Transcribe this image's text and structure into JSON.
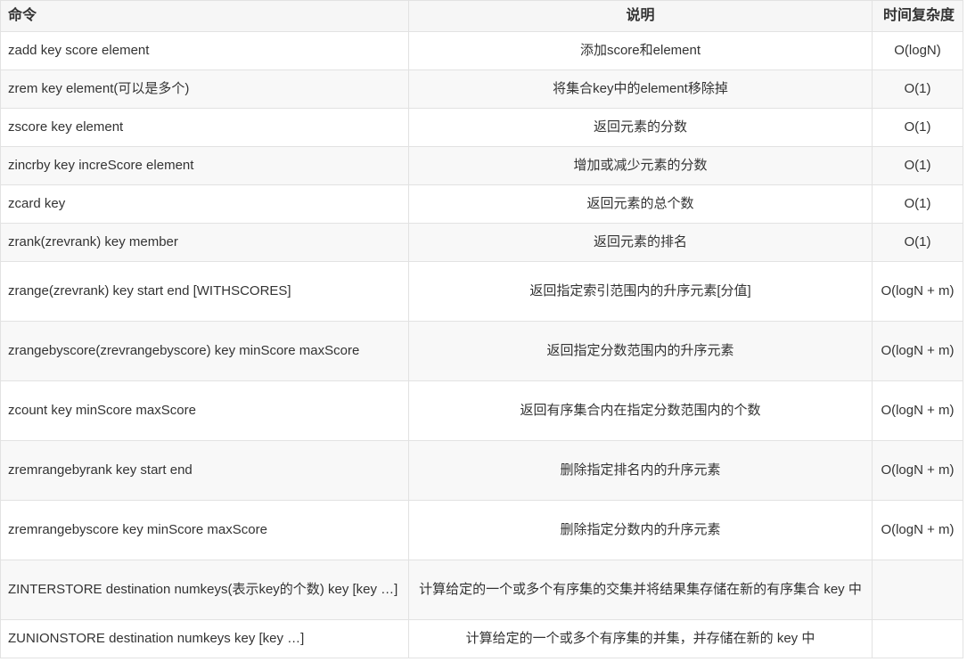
{
  "table": {
    "headers": {
      "command": "命令",
      "description": "说明",
      "complexity": "时间复杂度"
    },
    "rows": [
      {
        "command": "zadd key score element",
        "description": "添加score和element",
        "complexity": "O(logN)"
      },
      {
        "command": "zrem key element(可以是多个)",
        "description": "将集合key中的element移除掉",
        "complexity": "O(1)"
      },
      {
        "command": "zscore key element",
        "description": "返回元素的分数",
        "complexity": "O(1)"
      },
      {
        "command": "zincrby key increScore element",
        "description": "增加或减少元素的分数",
        "complexity": "O(1)"
      },
      {
        "command": "zcard key",
        "description": "返回元素的总个数",
        "complexity": "O(1)"
      },
      {
        "command": "zrank(zrevrank) key member",
        "description": "返回元素的排名",
        "complexity": "O(1)"
      },
      {
        "command": "zrange(zrevrank) key start end [WITHSCORES]",
        "description": "返回指定索引范围内的升序元素[分值]",
        "complexity": "O(logN + m)"
      },
      {
        "command": "zrangebyscore(zrevrangebyscore) key minScore maxScore",
        "description": "返回指定分数范围内的升序元素",
        "complexity": "O(logN + m)"
      },
      {
        "command": "zcount key minScore maxScore",
        "description": "返回有序集合内在指定分数范围内的个数",
        "complexity": "O(logN + m)"
      },
      {
        "command": "zremrangebyrank key start end",
        "description": "删除指定排名内的升序元素",
        "complexity": "O(logN + m)"
      },
      {
        "command": "zremrangebyscore key minScore maxScore",
        "description": "删除指定分数内的升序元素",
        "complexity": "O(logN + m)"
      },
      {
        "command": "ZINTERSTORE destination numkeys(表示key的个数) key [key …]",
        "description": "计算给定的一个或多个有序集的交集并将结果集存储在新的有序集合 key 中",
        "complexity": ""
      },
      {
        "command": "ZUNIONSTORE destination numkeys key [key …]",
        "description": "计算给定的一个或多个有序集的并集，并存储在新的 key 中",
        "complexity": ""
      }
    ]
  }
}
